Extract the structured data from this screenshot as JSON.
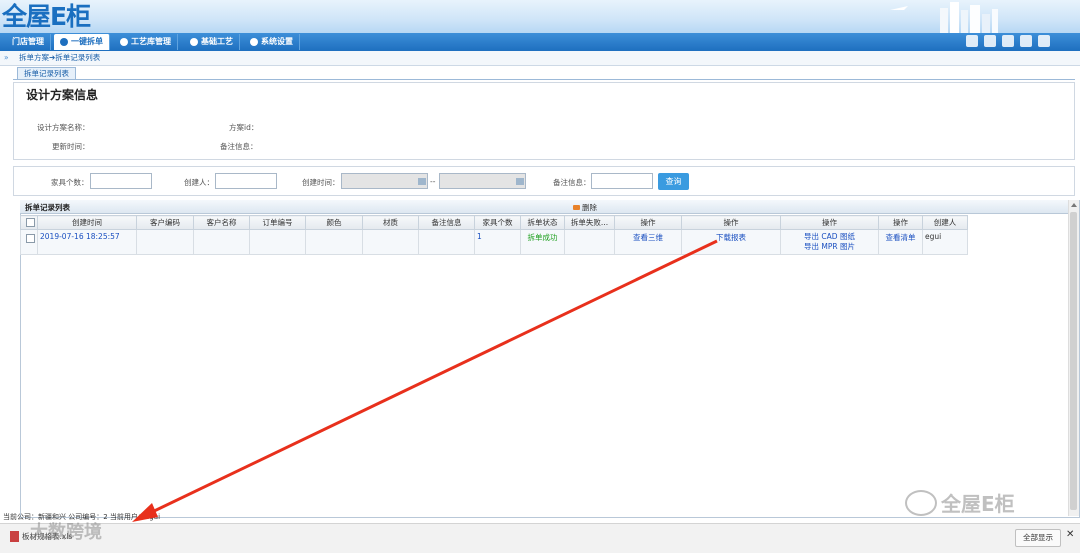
{
  "app": {
    "logo_text": "全屋E柜"
  },
  "nav": {
    "items": [
      "门店管理",
      "一键拆单",
      "工艺库管理",
      "基础工艺",
      "系统设置"
    ],
    "active": "一键拆单"
  },
  "breadcrumb": {
    "text": "拆单方案➔拆单记录列表"
  },
  "tab": {
    "label": "拆单记录列表"
  },
  "design_info": {
    "title": "设计方案信息",
    "labels": {
      "scheme_name": "设计方案名称：",
      "scheme_id": "方案id：",
      "update_time": "更新时间：",
      "remark": "备注信息："
    }
  },
  "search": {
    "furniture_count_label": "家具个数：",
    "creator_label": "创建人：",
    "create_time_label": "创建时间：",
    "range_sep": "--",
    "remark_label": "备注信息：",
    "query_button": "查询"
  },
  "grid": {
    "title": "拆单记录列表",
    "delete_label": "删除",
    "columns": [
      "创建时间",
      "客户编码",
      "客户名称",
      "订单编号",
      "颜色",
      "材质",
      "备注信息",
      "家具个数",
      "拆单状态",
      "拆单失败...",
      "操作",
      "操作",
      "操作",
      "操作",
      "创建人"
    ],
    "rows": [
      {
        "create_time": "2019-07-16 18:25:57",
        "customer_code": "",
        "customer_name": "",
        "order_no": "",
        "color": "",
        "material": "",
        "remark": "",
        "furniture_count": "1",
        "status": "拆单成功",
        "fail_reason": "",
        "op_view3d": "查看三维",
        "op_download": "下载报表",
        "op_export_cad": "导出 CAD 图纸",
        "op_export_mpr": "导出 MPR 图片",
        "op_view_list": "查看清单",
        "creator": "egui"
      }
    ]
  },
  "status_bar": {
    "text": "当前公司：新疆和兴    公司编号：2    当前用户：egui"
  },
  "bottom": {
    "download_item": "板材规格表.xls",
    "show_all": "全部显示",
    "close": "✕"
  },
  "watermarks": {
    "left": "大数跨境",
    "right": "全屋E柜"
  },
  "colors": {
    "nav": "#1e6fbf",
    "link": "#1a4fc0",
    "success": "#1fa01f",
    "arrow": "#e8301c"
  }
}
